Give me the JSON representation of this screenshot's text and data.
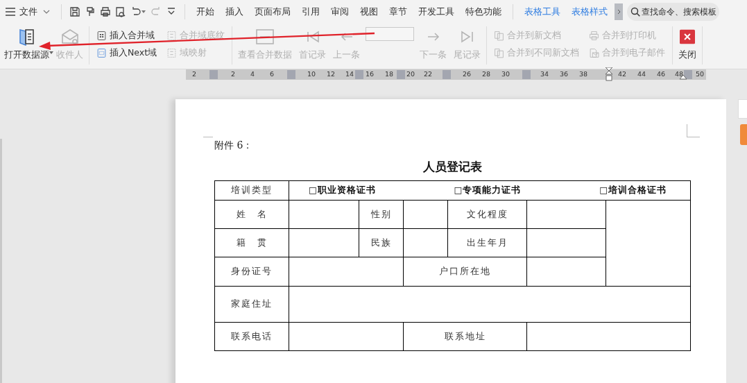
{
  "menu_bar": {
    "file_menu": "文件",
    "quick_access": [
      {
        "disabled": false
      },
      {
        "disabled": false
      },
      {
        "disabled": false
      },
      {
        "disabled": false
      },
      {
        "disabled": false
      },
      {
        "disabled": true
      },
      {
        "disabled": false
      }
    ],
    "tabs": [
      {
        "label": "开始",
        "kind": "main"
      },
      {
        "label": "插入",
        "kind": "main"
      },
      {
        "label": "页面布局",
        "kind": "main"
      },
      {
        "label": "引用",
        "kind": "main"
      },
      {
        "label": "审阅",
        "kind": "main"
      },
      {
        "label": "视图",
        "kind": "main"
      },
      {
        "label": "章节",
        "kind": "main"
      },
      {
        "label": "开发工具",
        "kind": "main"
      },
      {
        "label": "特色功能",
        "kind": "main"
      },
      {
        "label": "表格工具",
        "kind": "context"
      },
      {
        "label": "表格样式",
        "kind": "context"
      }
    ],
    "search": {
      "placeholder": "查找命令、搜索模板"
    }
  },
  "ribbon": {
    "groups": [
      {
        "items": [
          {
            "kind": "large",
            "label": "打开数据源",
            "disabled": false,
            "dropdown": true
          },
          {
            "kind": "large",
            "label": "收件人",
            "disabled": true
          }
        ]
      },
      {
        "items": [
          {
            "kind": "small",
            "label": "插入合并域",
            "disabled": false
          },
          {
            "kind": "small",
            "label": "合并域底纹",
            "disabled": true
          },
          {
            "kind": "small",
            "label": "插入Next域",
            "disabled": false
          },
          {
            "kind": "small",
            "label": "域映射",
            "disabled": true
          }
        ]
      },
      {
        "items": [
          {
            "kind": "large",
            "label": "查看合并数据",
            "disabled": true
          },
          {
            "kind": "large",
            "label": "首记录",
            "disabled": true
          },
          {
            "kind": "large",
            "label": "上一条",
            "disabled": true
          },
          {
            "kind": "field",
            "disabled": true
          },
          {
            "kind": "large",
            "label": "下一条",
            "disabled": true
          },
          {
            "kind": "large",
            "label": "尾记录",
            "disabled": true
          }
        ]
      },
      {
        "items": [
          {
            "kind": "small",
            "label": "合并到新文档",
            "disabled": true
          },
          {
            "kind": "small",
            "label": "合并到打印机",
            "disabled": true
          },
          {
            "kind": "small",
            "label": "合并到不同新文档",
            "disabled": true
          },
          {
            "kind": "small",
            "label": "合并到电子邮件",
            "disabled": true
          }
        ]
      },
      {
        "items": [
          {
            "kind": "close",
            "label": "关闭",
            "disabled": false
          }
        ]
      }
    ]
  },
  "ruler": {
    "ticks": [
      "2",
      "2",
      "4",
      "6",
      "10",
      "12",
      "14",
      "16",
      "18",
      "20",
      "22",
      "26",
      "28",
      "30",
      "34",
      "36",
      "38",
      "42",
      "44",
      "46",
      "48",
      "50"
    ]
  },
  "document": {
    "attachment_label": "附件 6：",
    "title": "人员登记表",
    "table": {
      "rows": [
        {
          "labels": [
            "培训类型"
          ],
          "options": [
            "□职业资格证书",
            "□专项能力证书",
            "□培训合格证书"
          ]
        },
        {
          "labels": [
            "姓　名",
            "性别",
            "文化程度"
          ]
        },
        {
          "labels": [
            "籍　贯",
            "民族",
            "出生年月"
          ]
        },
        {
          "labels": [
            "身份证号",
            "户口所在地"
          ]
        },
        {
          "labels": [
            "家庭住址"
          ]
        },
        {
          "labels": [
            "联系电话",
            "联系地址"
          ]
        }
      ]
    }
  }
}
